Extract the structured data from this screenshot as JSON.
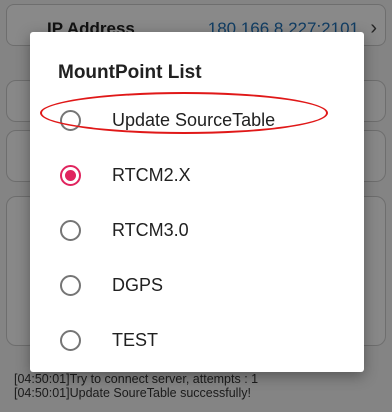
{
  "background": {
    "ip_label": "IP Address",
    "ip_value": "180.166.8.227:2101",
    "log_lines": [
      "[04:50:01]Try to connect server, attempts : 1",
      "[04:50:01]Update SoureTable successfully!"
    ]
  },
  "dialog": {
    "title": "MountPoint List",
    "options": [
      {
        "label": "Update SourceTable",
        "checked": false
      },
      {
        "label": "RTCM2.X",
        "checked": true
      },
      {
        "label": "RTCM3.0",
        "checked": false
      },
      {
        "label": "DGPS",
        "checked": false
      },
      {
        "label": "TEST",
        "checked": false
      }
    ]
  },
  "colors": {
    "accent": "#e0245e",
    "annotation": "#e01818"
  },
  "icons": {
    "chevron": "chevron-right-icon"
  }
}
